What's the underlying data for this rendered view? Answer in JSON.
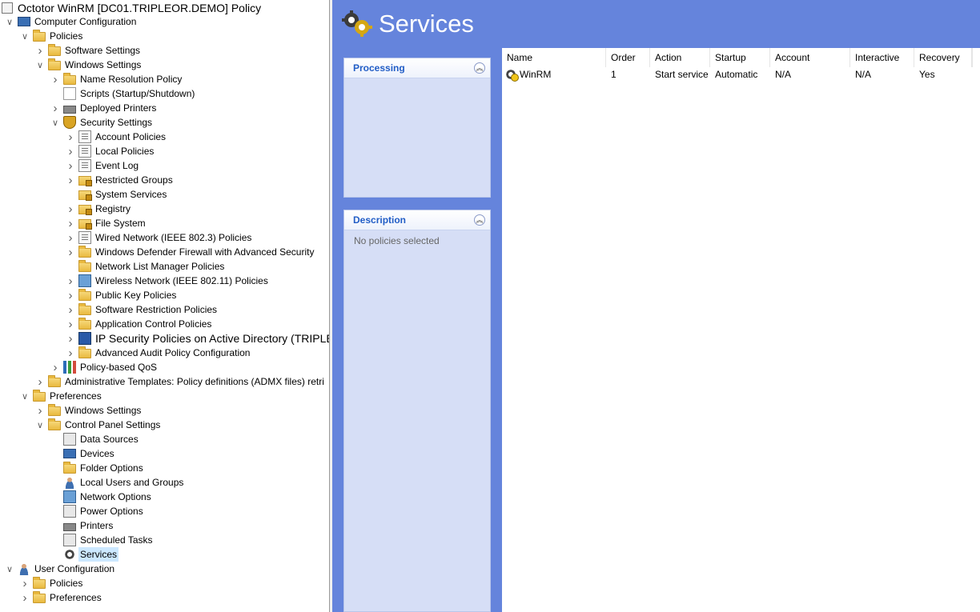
{
  "tree": {
    "title": "Octotor WinRM [DC01.TRIPLEOR.DEMO] Policy",
    "items": [
      {
        "label": "Computer Configuration",
        "chev": "v",
        "icon": "computer"
      },
      {
        "label": "Policies",
        "chev": "v",
        "icon": "folder"
      },
      {
        "label": "Software Settings",
        "chev": ">",
        "icon": "folder"
      },
      {
        "label": "Windows Settings",
        "chev": "v",
        "icon": "folder"
      },
      {
        "label": "Name Resolution Policy",
        "chev": ">",
        "icon": "folder"
      },
      {
        "label": "Scripts (Startup/Shutdown)",
        "chev": "",
        "icon": "script"
      },
      {
        "label": "Deployed Printers",
        "chev": ">",
        "icon": "printer"
      },
      {
        "label": "Security Settings",
        "chev": "v",
        "icon": "shield"
      },
      {
        "label": "Account Policies",
        "chev": ">",
        "icon": "doc"
      },
      {
        "label": "Local Policies",
        "chev": ">",
        "icon": "doc"
      },
      {
        "label": "Event Log",
        "chev": ">",
        "icon": "doc"
      },
      {
        "label": "Restricted Groups",
        "chev": ">",
        "icon": "lockfolder"
      },
      {
        "label": "System Services",
        "chev": "",
        "icon": "lockfolder"
      },
      {
        "label": "Registry",
        "chev": ">",
        "icon": "lockfolder"
      },
      {
        "label": "File System",
        "chev": ">",
        "icon": "lockfolder"
      },
      {
        "label": "Wired Network (IEEE 802.3) Policies",
        "chev": ">",
        "icon": "doc"
      },
      {
        "label": "Windows Defender Firewall with Advanced Security",
        "chev": ">",
        "icon": "folder"
      },
      {
        "label": "Network List Manager Policies",
        "chev": "",
        "icon": "folder"
      },
      {
        "label": "Wireless Network (IEEE 802.11) Policies",
        "chev": ">",
        "icon": "net"
      },
      {
        "label": "Public Key Policies",
        "chev": ">",
        "icon": "folder"
      },
      {
        "label": "Software Restriction Policies",
        "chev": ">",
        "icon": "folder"
      },
      {
        "label": "Application Control Policies",
        "chev": ">",
        "icon": "folder"
      },
      {
        "label": "IP Security Policies on Active Directory (TRIPLEOR",
        "chev": ">",
        "icon": "ipsec"
      },
      {
        "label": "Advanced Audit Policy Configuration",
        "chev": ">",
        "icon": "folder"
      },
      {
        "label": "Policy-based QoS",
        "chev": ">",
        "icon": "bars"
      },
      {
        "label": "Administrative Templates: Policy definitions (ADMX files) retri",
        "chev": ">",
        "icon": "folder"
      },
      {
        "label": "Preferences",
        "chev": "v",
        "icon": "folder"
      },
      {
        "label": "Windows Settings",
        "chev": ">",
        "icon": "folder"
      },
      {
        "label": "Control Panel Settings",
        "chev": "v",
        "icon": "folder"
      },
      {
        "label": "Data Sources",
        "chev": "",
        "icon": "mono"
      },
      {
        "label": "Devices",
        "chev": "",
        "icon": "computer"
      },
      {
        "label": "Folder Options",
        "chev": "",
        "icon": "folder"
      },
      {
        "label": "Local Users and Groups",
        "chev": "",
        "icon": "user"
      },
      {
        "label": "Network Options",
        "chev": "",
        "icon": "net"
      },
      {
        "label": "Power Options",
        "chev": "",
        "icon": "mono"
      },
      {
        "label": "Printers",
        "chev": "",
        "icon": "printer"
      },
      {
        "label": "Scheduled Tasks",
        "chev": "",
        "icon": "mono"
      },
      {
        "label": "Services",
        "chev": "",
        "icon": "gear"
      },
      {
        "label": "User Configuration",
        "chev": "v",
        "icon": "user"
      },
      {
        "label": "Policies",
        "chev": ">",
        "icon": "folder"
      },
      {
        "label": "Preferences",
        "chev": ">",
        "icon": "folder"
      }
    ]
  },
  "header": {
    "title": "Services",
    "icon": "services-gear-icon"
  },
  "panels": {
    "processing": {
      "title": "Processing"
    },
    "description": {
      "title": "Description",
      "body": "No policies selected"
    }
  },
  "listview": {
    "columns": [
      "Name",
      "Order",
      "Action",
      "Startup",
      "Account",
      "Interactive",
      "Recovery"
    ],
    "rows": [
      [
        "WinRM",
        "1",
        "Start service",
        "Automatic",
        "N/A",
        "N/A",
        "Yes"
      ]
    ]
  },
  "colors": {
    "header_bg": "#6584dc",
    "panel_bg": "#d6def6",
    "panel_title": "#215dc6",
    "selection": "#cce8ff"
  }
}
